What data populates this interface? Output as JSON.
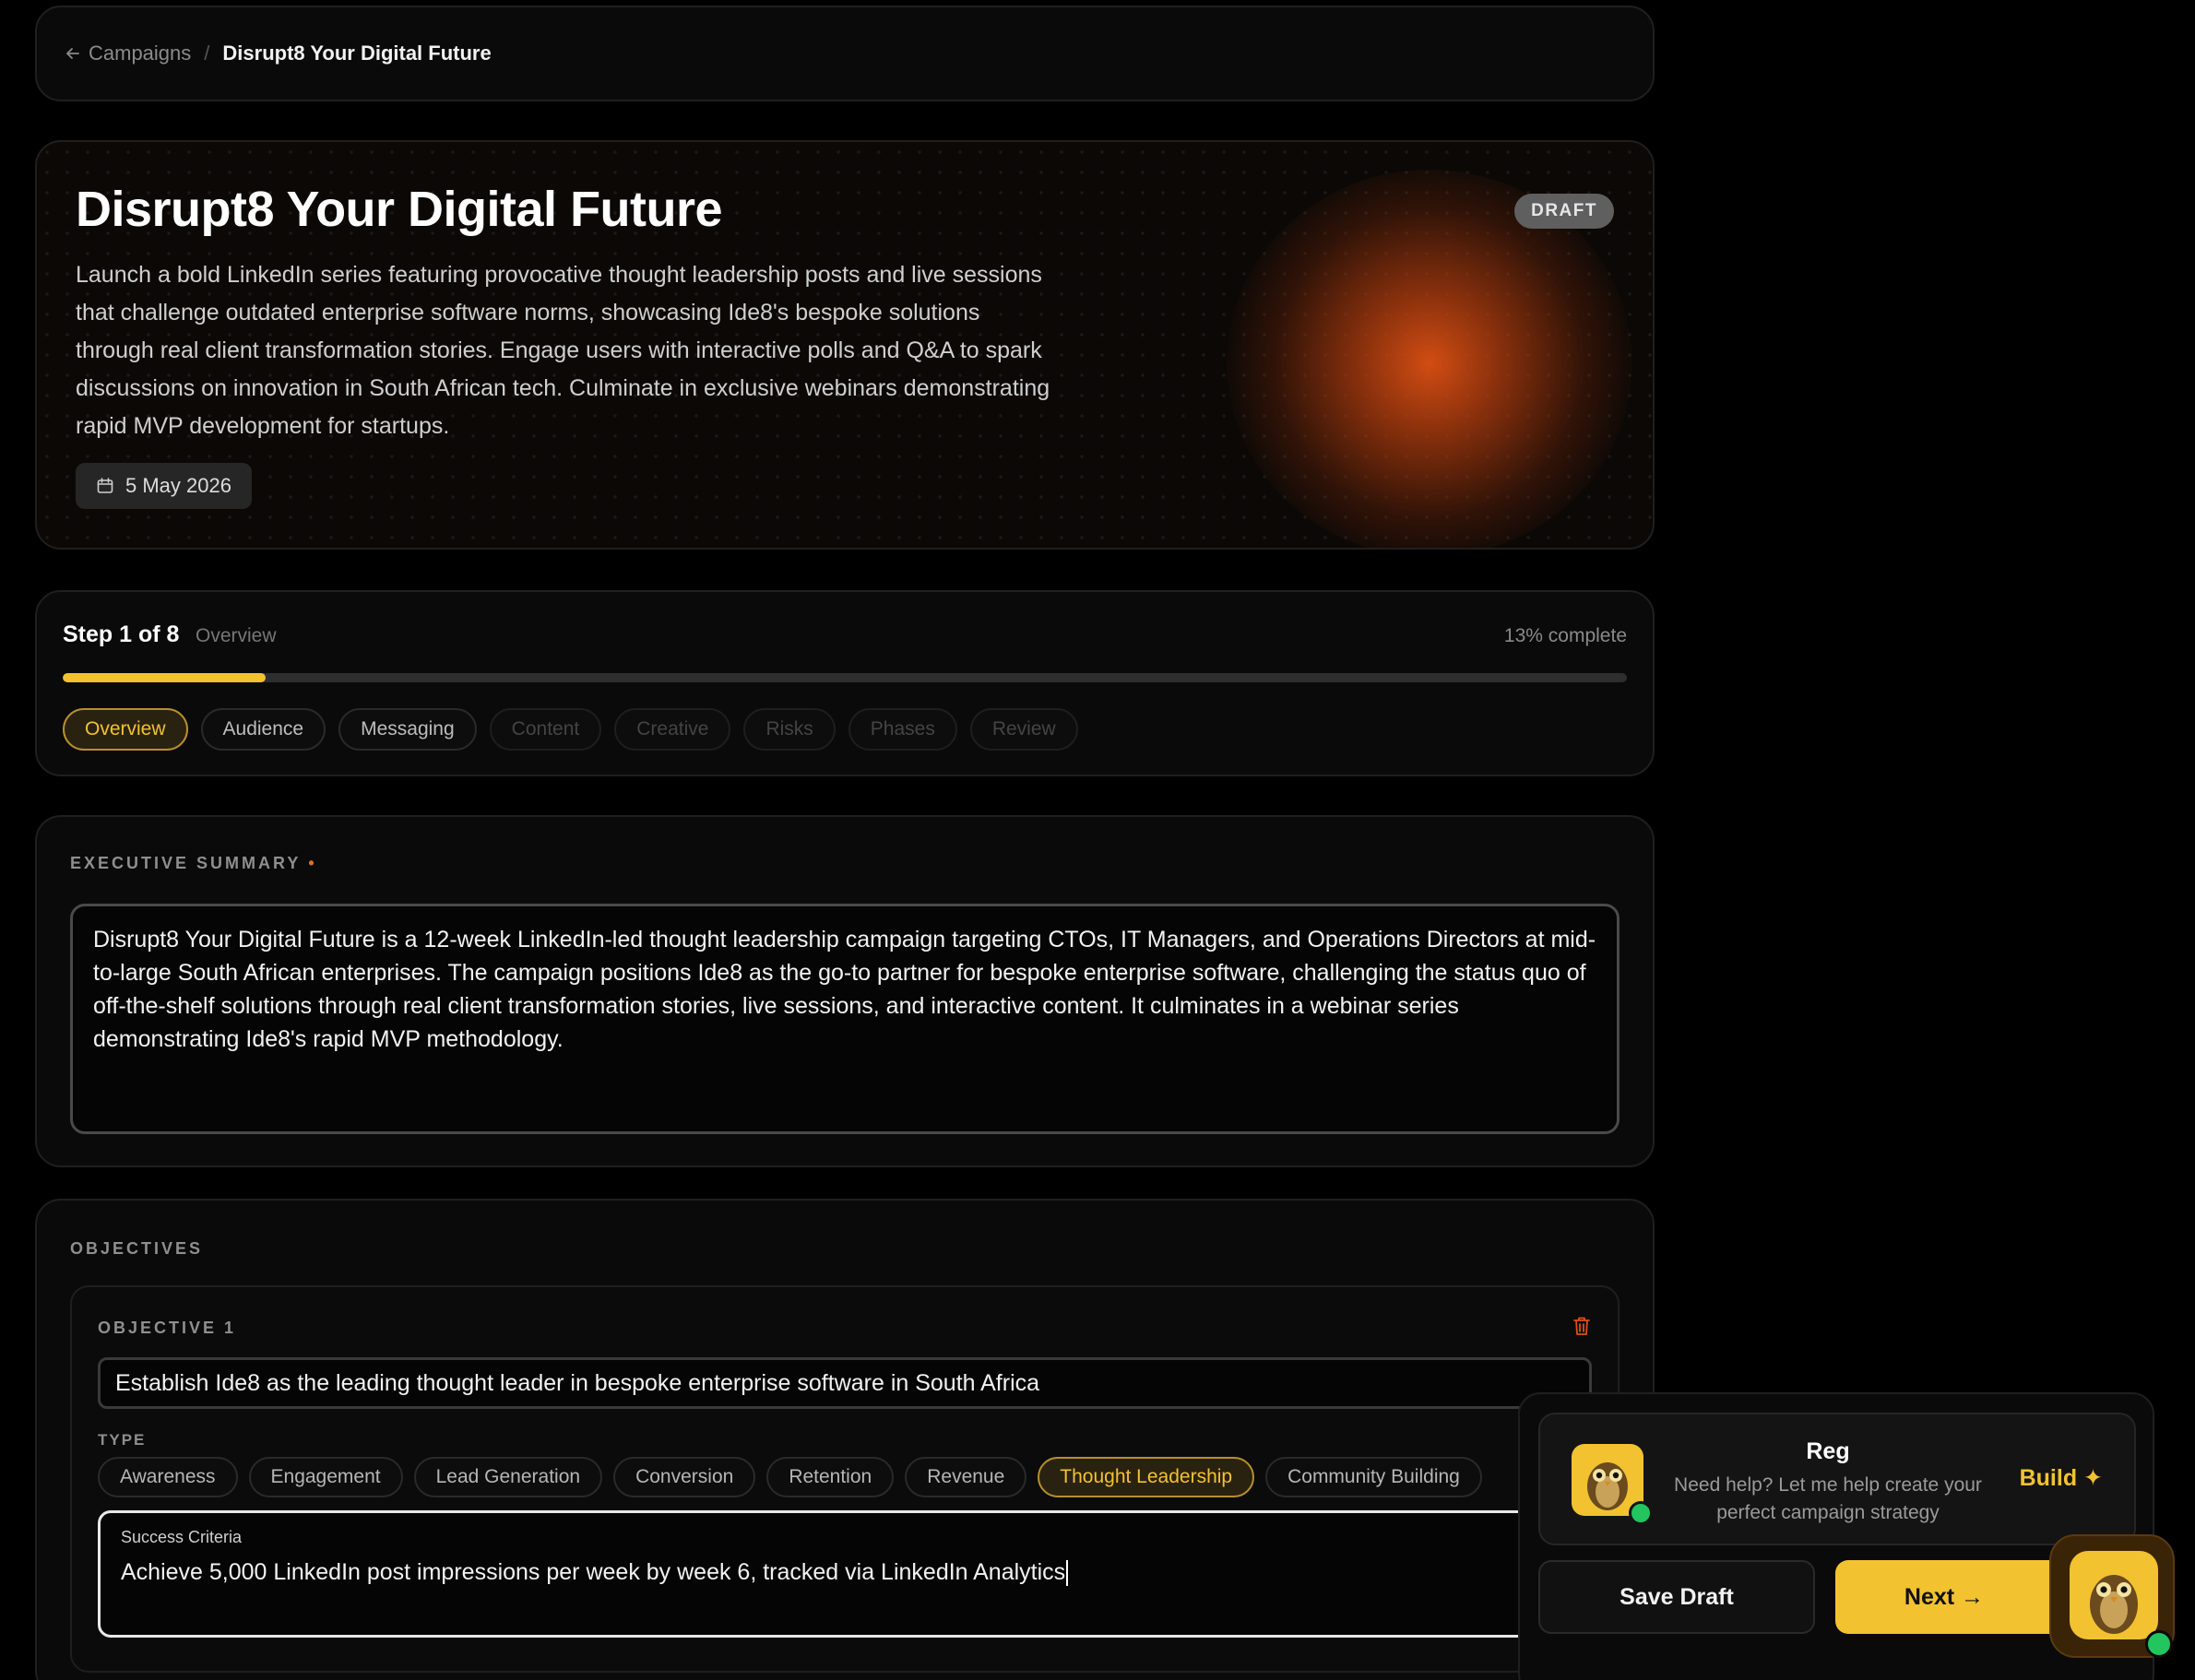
{
  "breadcrumb": {
    "back_label": "Campaigns",
    "separator": "/",
    "current": "Disrupt8 Your Digital Future"
  },
  "hero": {
    "title": "Disrupt8 Your Digital Future",
    "description": "Launch a bold LinkedIn series featuring provocative thought leadership posts and live sessions that challenge outdated enterprise software norms, showcasing Ide8's bespoke solutions through real client transformation stories. Engage users with interactive polls and Q&A to spark discussions on innovation in South African tech. Culminate in exclusive webinars demonstrating rapid MVP development for startups.",
    "status": "DRAFT",
    "date": "5 May 2026",
    "date_icon": "calendar-icon"
  },
  "step": {
    "title": "Step 1 of 8",
    "subtitle": "Overview",
    "percent_label": "13% complete",
    "progress": 0.13,
    "tabs": [
      {
        "label": "Overview",
        "state": "active"
      },
      {
        "label": "Audience",
        "state": "enabled"
      },
      {
        "label": "Messaging",
        "state": "enabled"
      },
      {
        "label": "Content",
        "state": "disabled"
      },
      {
        "label": "Creative",
        "state": "disabled"
      },
      {
        "label": "Risks",
        "state": "disabled"
      },
      {
        "label": "Phases",
        "state": "disabled"
      },
      {
        "label": "Review",
        "state": "disabled"
      }
    ]
  },
  "executive_summary": {
    "label": "EXECUTIVE SUMMARY",
    "required_marker": "•",
    "value": "Disrupt8 Your Digital Future is a 12-week LinkedIn-led thought leadership campaign targeting CTOs, IT Managers, and Operations Directors at mid-to-large South African enterprises. The campaign positions Ide8 as the go-to partner for bespoke enterprise software, challenging the status quo of off-the-shelf solutions through real client transformation stories, live sessions, and interactive content. It culminates in a webinar series demonstrating Ide8's rapid MVP methodology."
  },
  "objectives": {
    "label": "OBJECTIVES",
    "items": [
      {
        "label": "OBJECTIVE 1",
        "value": "Establish Ide8 as the leading thought leader in bespoke enterprise software in South Africa",
        "type_label": "TYPE",
        "types": [
          "Awareness",
          "Engagement",
          "Lead Generation",
          "Conversion",
          "Retention",
          "Revenue",
          "Thought Leadership",
          "Community Building"
        ],
        "selected_type": "Thought Leadership",
        "success_label": "Success Criteria",
        "success_value": "Achieve 5,000 LinkedIn post impressions per week by week 6, tracked via LinkedIn Analytics"
      }
    ]
  },
  "assistant": {
    "name": "Reg",
    "message": "Need help? Let me help create your perfect campaign strategy",
    "build_label": "Build ✦",
    "save_label": "Save Draft",
    "next_label": "Next →",
    "status_color": "#22c55e"
  },
  "colors": {
    "accent": "#f2c230",
    "glow": "#d9501a",
    "background": "#000000"
  }
}
